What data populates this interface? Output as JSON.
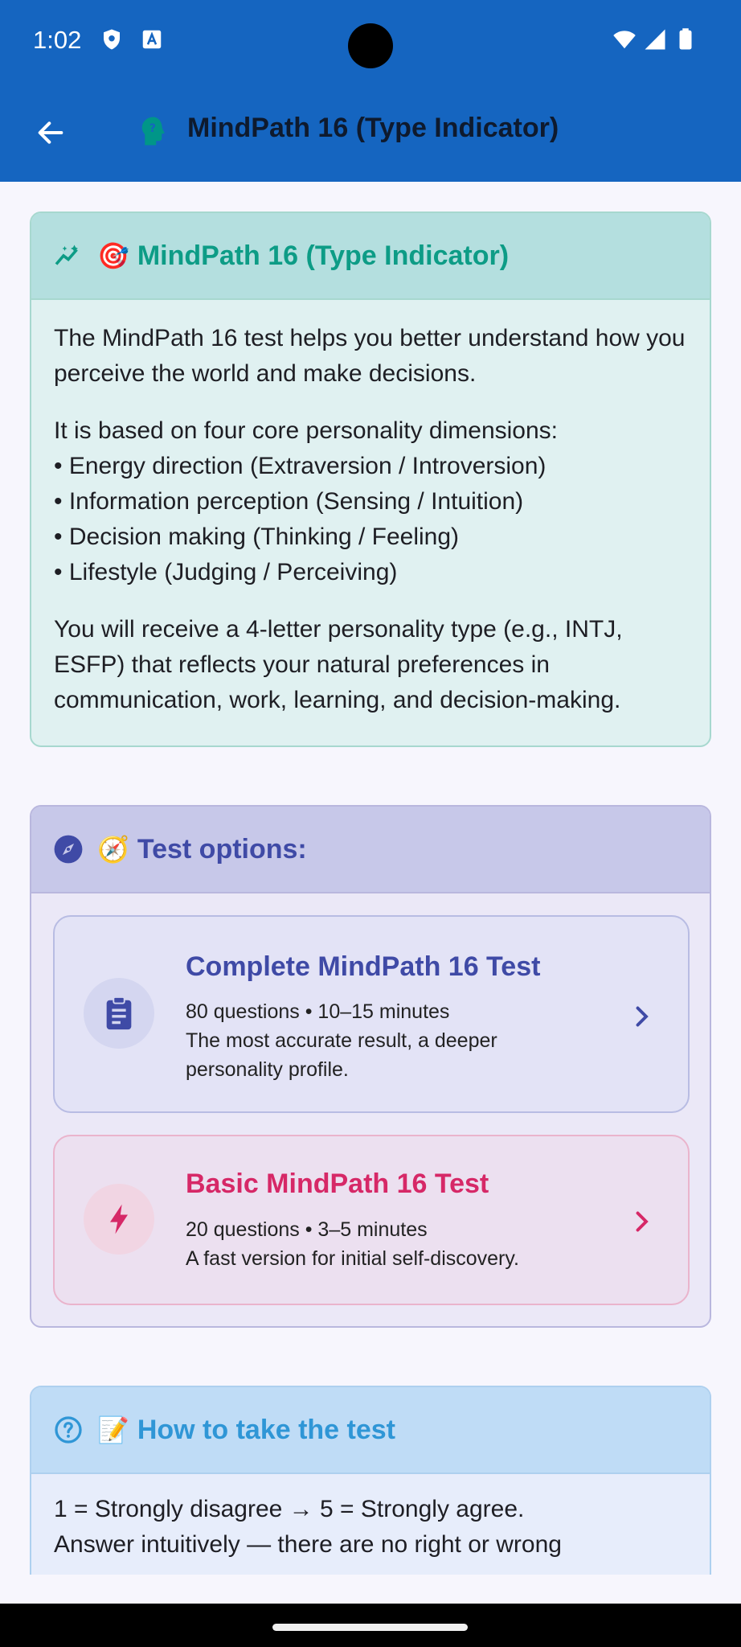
{
  "status_bar": {
    "time": "1:02"
  },
  "app_bar": {
    "title": "MindPath 16 (Type Indicator)",
    "colors": {
      "background": "#1565c0",
      "icon": "#009688"
    }
  },
  "about_card": {
    "emoji": "🎯",
    "title": "MindPath 16 (Type Indicator)",
    "paragraph1": "The MindPath 16 test helps you better understand how you perceive the world and make decisions.",
    "dimensions_intro": "It is based on four core personality dimensions:",
    "dimensions": [
      "• Energy direction (Extraversion / Introversion)",
      "• Information perception (Sensing / Intuition)",
      "• Decision making (Thinking / Feeling)",
      "• Lifestyle (Judging / Perceiving)"
    ],
    "paragraph3": "You will receive a 4-letter personality type (e.g., INTJ, ESFP) that reflects your natural preferences in communication, work, learning, and decision-making."
  },
  "options_card": {
    "emoji": "🧭",
    "title": "Test options:",
    "options": [
      {
        "title": "Complete MindPath 16 Test",
        "meta": "80 questions • 10–15 minutes",
        "description": "The most accurate result, a deeper personality profile.",
        "icon": "clipboard-icon",
        "color": "#3f4aa6"
      },
      {
        "title": "Basic MindPath 16 Test",
        "meta": "20 questions • 3–5 minutes",
        "description": "A fast version for initial self-discovery.",
        "icon": "lightning-icon",
        "color": "#d62867"
      }
    ]
  },
  "howto_card": {
    "emoji": "📝",
    "title": "How to take the test",
    "line1": "1 = Strongly disagree → 5 = Strongly agree.",
    "line2": "Answer intuitively — there are no right or wrong"
  }
}
